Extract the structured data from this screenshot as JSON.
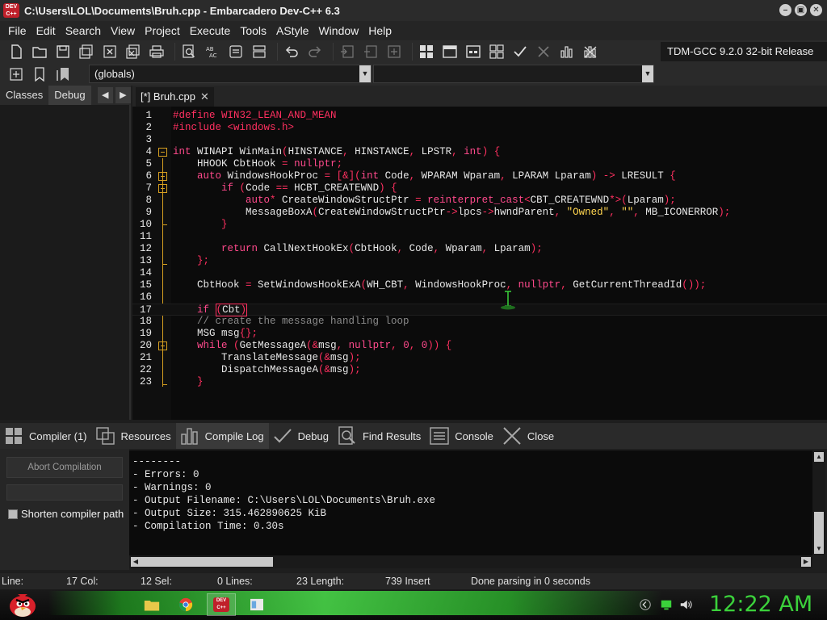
{
  "window": {
    "title": "C:\\Users\\LOL\\Documents\\Bruh.cpp - Embarcadero Dev-C++ 6.3",
    "app_icon_text": "DEV C++"
  },
  "menu": [
    "File",
    "Edit",
    "Search",
    "View",
    "Project",
    "Execute",
    "Tools",
    "AStyle",
    "Window",
    "Help"
  ],
  "toolbar": {
    "compiler_set": "TDM-GCC 9.2.0 32-bit Release",
    "scope_combo": "(globals)",
    "symbol_combo": ""
  },
  "left_panel": {
    "tabs": [
      "Classes",
      "Debug"
    ],
    "active_tab": "Debug"
  },
  "editor": {
    "tab_label": "[*] Bruh.cpp",
    "current_line": 17,
    "lines": [
      {
        "n": "1",
        "html": "<span class='pp'>#define WIN32_LEAN_AND_MEAN</span>"
      },
      {
        "n": "2",
        "html": "<span class='pp'>#include &lt;windows.h&gt;</span>"
      },
      {
        "n": "3",
        "html": ""
      },
      {
        "n": "4",
        "html": "<span class='k'>int</span> WINAPI WinMain<span class='p'>(</span>HINSTANCE<span class='p'>,</span> HINSTANCE<span class='p'>,</span> LPSTR<span class='p'>,</span> <span class='k'>int</span><span class='p'>) {</span>"
      },
      {
        "n": "5",
        "html": "    HHOOK CbtHook <span class='p'>=</span> <span class='k'>nullptr</span><span class='p'>;</span>"
      },
      {
        "n": "6",
        "html": "    <span class='k'>auto</span> WindowsHookProc <span class='p'>= [&amp;](</span><span class='k'>int</span> Code<span class='p'>,</span> WPARAM Wparam<span class='p'>,</span> LPARAM Lparam<span class='p'>) -&gt;</span> LRESULT <span class='p'>{</span>"
      },
      {
        "n": "7",
        "html": "        <span class='k'>if</span> <span class='p'>(</span>Code <span class='p'>==</span> HCBT_CREATEWND<span class='p'>) {</span>"
      },
      {
        "n": "8",
        "html": "            <span class='k'>auto</span><span class='p'>*</span> CreateWindowStructPtr <span class='p'>=</span> <span class='k'>reinterpret_cast</span><span class='p'>&lt;</span>CBT_CREATEWND<span class='p'>*&gt;(</span>Lparam<span class='p'>);</span>"
      },
      {
        "n": "9",
        "html": "            MessageBoxA<span class='p'>(</span>CreateWindowStructPtr<span class='p'>-&gt;</span>lpcs<span class='p'>-&gt;</span>hwndParent<span class='p'>,</span> <span class='s'>\"Owned\"</span><span class='p'>,</span> <span class='s'>\"\"</span><span class='p'>,</span> MB_ICONERROR<span class='p'>);</span>"
      },
      {
        "n": "10",
        "html": "        <span class='p'>}</span>"
      },
      {
        "n": "11",
        "html": ""
      },
      {
        "n": "12",
        "html": "        <span class='k'>return</span> CallNextHookEx<span class='p'>(</span>CbtHook<span class='p'>,</span> Code<span class='p'>,</span> Wparam<span class='p'>,</span> Lparam<span class='p'>);</span>"
      },
      {
        "n": "13",
        "html": "    <span class='p'>};</span>"
      },
      {
        "n": "14",
        "html": ""
      },
      {
        "n": "15",
        "html": "    CbtHook <span class='p'>=</span> SetWindowsHookExA<span class='p'>(</span>WH_CBT<span class='p'>,</span> WindowsHookProc<span class='p'>,</span> <span class='k'>nullptr</span><span class='p'>,</span> GetCurrentThreadId<span class='p'>());</span>"
      },
      {
        "n": "16",
        "html": ""
      },
      {
        "n": "17",
        "html": "    <span class='k'>if</span> <span class='caret-box'><span class='p'>(</span>Cbt<span class='p'>)</span></span>"
      },
      {
        "n": "18",
        "html": "    <span class='c'>// create the message handling loop</span>"
      },
      {
        "n": "19",
        "html": "    MSG msg<span class='p'>{};</span>"
      },
      {
        "n": "20",
        "html": "    <span class='k'>while</span> <span class='p'>(</span>GetMessageA<span class='p'>(&amp;</span>msg<span class='p'>,</span> <span class='k'>nullptr</span><span class='p'>,</span> <span class='n'>0</span><span class='p'>,</span> <span class='n'>0</span><span class='p'>)) {</span>"
      },
      {
        "n": "21",
        "html": "        TranslateMessage<span class='p'>(&amp;</span>msg<span class='p'>);</span>"
      },
      {
        "n": "22",
        "html": "        DispatchMessageA<span class='p'>(&amp;</span>msg<span class='p'>);</span>"
      },
      {
        "n": "23",
        "html": "    <span class='p'>}</span>"
      }
    ]
  },
  "bottom_tabs": [
    {
      "label": "Compiler (1)",
      "icon": "grid-icon"
    },
    {
      "label": "Resources",
      "icon": "resources-icon"
    },
    {
      "label": "Compile Log",
      "icon": "chart-icon",
      "active": true
    },
    {
      "label": "Debug",
      "icon": "check-icon"
    },
    {
      "label": "Find Results",
      "icon": "find-icon"
    },
    {
      "label": "Console",
      "icon": "console-icon"
    },
    {
      "label": "Close",
      "icon": "close-icon"
    }
  ],
  "compile_panel": {
    "abort_label": "Abort Compilation",
    "shorten_label": "Shorten compiler path",
    "log": [
      "--------",
      "- Errors: 0",
      "- Warnings: 0",
      "- Output Filename: C:\\Users\\LOL\\Documents\\Bruh.exe",
      "- Output Size: 315.462890625 KiB",
      "- Compilation Time: 0.30s"
    ]
  },
  "status": {
    "line": "Line:",
    "col": "17 Col:",
    "sel": "12 Sel:",
    "lines": "0 Lines:",
    "length": "23 Length:",
    "insert": "739 Insert",
    "message": "Done parsing in 0 seconds"
  },
  "taskbar": {
    "clock": "12:22 AM",
    "devcpp_icon_text": "DEV C++"
  },
  "colors": {
    "keyword": "#ff4a8c",
    "string": "#ffd54f",
    "fold": "#d8a020",
    "clock": "#3bd13b"
  }
}
